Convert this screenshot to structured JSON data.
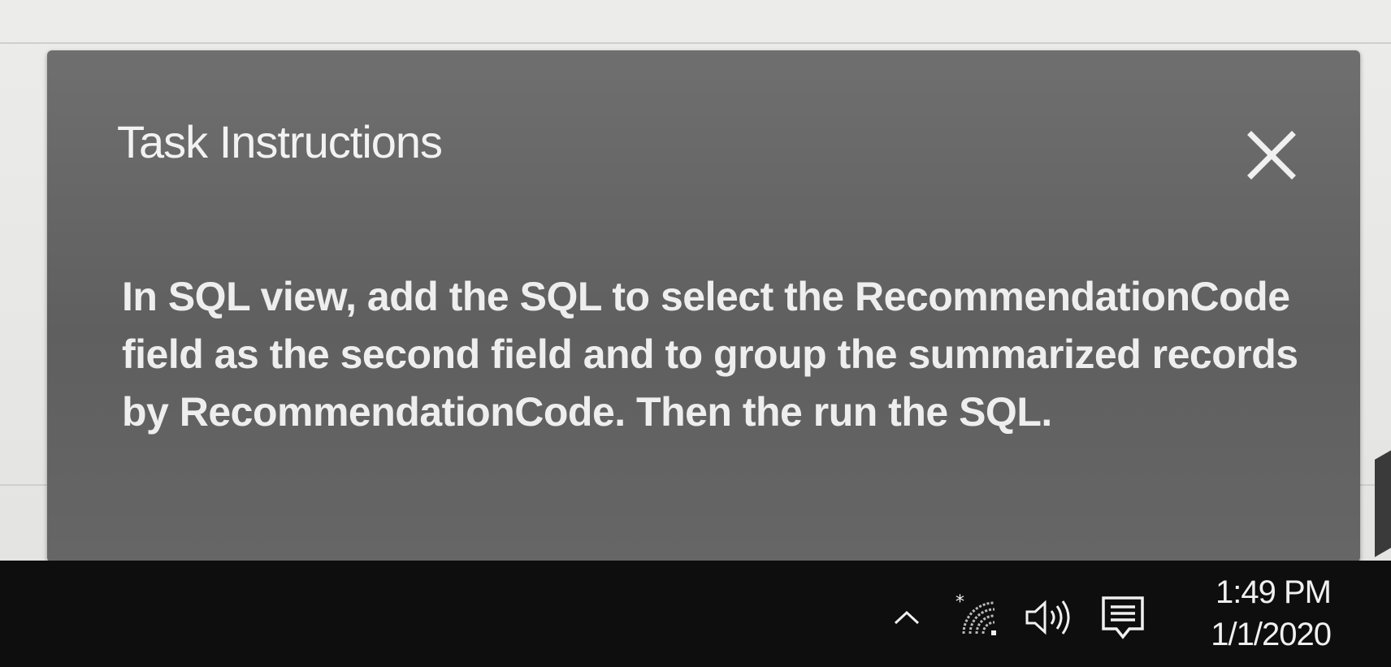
{
  "panel": {
    "title": "Task Instructions",
    "close_icon": "close-icon",
    "instruction_text": "In SQL view, add the SQL to select the RecommendationCode field as the second field and to group the summarized records by RecommendationCode. Then the run the SQL."
  },
  "taskbar": {
    "icons": [
      "chevron-up-icon",
      "wifi-icon",
      "volume-icon",
      "notification-icon"
    ],
    "time": "1:49 PM",
    "date": "1/1/2020"
  },
  "colors": {
    "panel_bg": "#666666",
    "panel_text": "#eeeeee",
    "taskbar_bg": "#0e0e0f"
  }
}
